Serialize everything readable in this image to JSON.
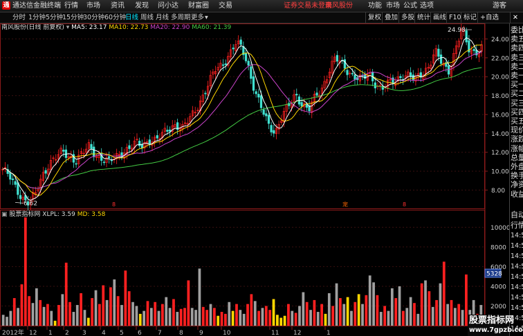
{
  "menubar": {
    "app_title": "通达信金融终端",
    "menus": [
      "行情",
      "市场",
      "资讯",
      "发现",
      "问小达",
      "财富圈",
      "交易"
    ],
    "notice": "证券交易未登录",
    "stock_name": "南风股份",
    "right_menus": [
      "功能",
      "市场",
      "公式",
      "选项"
    ],
    "user": "游客"
  },
  "toolbar": {
    "periods": [
      "分时",
      "1分钟",
      "5分钟",
      "15分钟",
      "30分钟",
      "60分钟",
      "日线",
      "周线",
      "月线",
      "多周期",
      "更多"
    ],
    "active_period": "日线",
    "right_buttons": [
      "复权",
      "叠加",
      "多股",
      "统计",
      "画线",
      "F10",
      "标记",
      "+自选"
    ]
  },
  "main_legend": {
    "title": "南风股份(日线 前复权)",
    "ma5": "MA5: 23.17",
    "ma10": "MA10: 22.73",
    "ma20": "MA20: 22.90",
    "ma60": "MA60: 21.39"
  },
  "volume_legend": {
    "title": "股票指标网",
    "xlpl": "XLPL: 3.59",
    "md": "MD: 3.58"
  },
  "annotations": {
    "high_label": "24.98",
    "low_label": "6.62",
    "markers": [
      "8",
      "宠",
      "8"
    ]
  },
  "price_axis": [
    "24.00",
    "22.00",
    "20.00",
    "18.00",
    "16.00",
    "14.00",
    "12.00",
    "10.00",
    "8.00"
  ],
  "volume_axis": [
    "10000",
    "8000",
    "6000",
    "4000",
    "2000"
  ],
  "volume_current": "5328",
  "date_axis": [
    "2012年",
    "12",
    "1",
    "2",
    "3",
    "4",
    "5",
    "6",
    "7",
    "8",
    "9",
    "10",
    "11",
    "12",
    "1"
  ],
  "side_panel": {
    "top": [
      "委比",
      "卖五",
      "卖四",
      "卖三",
      "卖二",
      "卖一",
      "买一",
      "买二",
      "买三",
      "买四",
      "买五",
      "现价",
      "涨跌",
      "涨幅",
      "总量",
      "外盘",
      "换手",
      "净资",
      "收益"
    ],
    "bottom": [
      "自动",
      "行情",
      "14:50",
      "14:50",
      "14:50",
      "14:50",
      "14:50",
      "14:50",
      "14:50",
      "14:50",
      "14:50",
      "14:50"
    ]
  },
  "watermark": {
    "line1": "股票指标网",
    "line2": "www.7gpzb.com"
  },
  "colors": {
    "up": "#ff2020",
    "down": "#a0a0a0",
    "ma5": "#ffffff",
    "ma10": "#ffd700",
    "ma20": "#cc44cc",
    "ma60": "#44cc44",
    "active": "#00e5ff"
  },
  "chart_data": {
    "type": "bar",
    "title": "南风股份(日线 前复权)",
    "price_range": [
      6.62,
      24.98
    ],
    "ylim_price": [
      6.5,
      25.2
    ],
    "ylim_volume": [
      0,
      11500
    ],
    "price_path": [
      10.2,
      9.4,
      8.2,
      7.2,
      6.62,
      7.6,
      9.6,
      10.9,
      11.4,
      12.0,
      11.6,
      11.2,
      11.8,
      12.6,
      11.8,
      11.3,
      10.9,
      11.5,
      12.1,
      12.4,
      12.9,
      12.7,
      13.4,
      13.2,
      13.8,
      14.6,
      15.0,
      14.4,
      15.4,
      16.6,
      17.8,
      19.2,
      20.8,
      21.4,
      22.2,
      23.4,
      23.1,
      21.0,
      18.2,
      16.4,
      14.9,
      14.2,
      15.8,
      16.8,
      18.2,
      17.2,
      16.4,
      17.8,
      18.8,
      20.6,
      21.9,
      21.3,
      20.6,
      20.0,
      19.6,
      20.3,
      19.4,
      18.7,
      19.2,
      19.6,
      20.2,
      20.1,
      19.6,
      20.4,
      21.1,
      22.6,
      21.4,
      20.6,
      22.8,
      24.98,
      22.9,
      22.6,
      23.2
    ],
    "volume_bars": [
      {
        "v": 1100,
        "c": "down"
      },
      {
        "v": 900,
        "c": "down"
      },
      {
        "v": 1500,
        "c": "down"
      },
      {
        "v": 2800,
        "c": "up"
      },
      {
        "v": 1800,
        "c": "down"
      },
      {
        "v": 4200,
        "c": "up"
      },
      {
        "v": 11000,
        "c": "up"
      },
      {
        "v": 3000,
        "c": "up"
      },
      {
        "v": 2300,
        "c": "down"
      },
      {
        "v": 3800,
        "c": "down"
      },
      {
        "v": 2600,
        "c": "up"
      },
      {
        "v": 1900,
        "c": "down"
      },
      {
        "v": 2200,
        "c": "up"
      },
      {
        "v": 1500,
        "c": "down"
      },
      {
        "v": 500,
        "c": "yellow"
      },
      {
        "v": 2100,
        "c": "up"
      },
      {
        "v": 3200,
        "c": "down"
      },
      {
        "v": 6400,
        "c": "up"
      },
      {
        "v": 2400,
        "c": "up"
      },
      {
        "v": 1400,
        "c": "down"
      },
      {
        "v": 2100,
        "c": "down"
      },
      {
        "v": 3300,
        "c": "up"
      },
      {
        "v": 1600,
        "c": "down"
      },
      {
        "v": 800,
        "c": "yellow"
      },
      {
        "v": 2800,
        "c": "up"
      },
      {
        "v": 3600,
        "c": "down"
      },
      {
        "v": 2200,
        "c": "up"
      },
      {
        "v": 4100,
        "c": "up"
      },
      {
        "v": 2600,
        "c": "down"
      },
      {
        "v": 3900,
        "c": "up"
      },
      {
        "v": 4700,
        "c": "down"
      },
      {
        "v": 3000,
        "c": "up"
      },
      {
        "v": 2100,
        "c": "down"
      },
      {
        "v": 5600,
        "c": "up"
      },
      {
        "v": 3500,
        "c": "up"
      },
      {
        "v": 2400,
        "c": "down"
      },
      {
        "v": 2000,
        "c": "down"
      },
      {
        "v": 1200,
        "c": "yellow"
      },
      {
        "v": 1500,
        "c": "down"
      },
      {
        "v": 2500,
        "c": "up"
      },
      {
        "v": 1800,
        "c": "down"
      },
      {
        "v": 2400,
        "c": "up"
      },
      {
        "v": 1500,
        "c": "down"
      },
      {
        "v": 2200,
        "c": "up"
      },
      {
        "v": 2900,
        "c": "down"
      },
      {
        "v": 1800,
        "c": "down"
      },
      {
        "v": 2700,
        "c": "up"
      },
      {
        "v": 1400,
        "c": "down"
      },
      {
        "v": 1700,
        "c": "up"
      },
      {
        "v": 1800,
        "c": "up"
      },
      {
        "v": 4600,
        "c": "up"
      },
      {
        "v": 1800,
        "c": "down"
      },
      {
        "v": 1600,
        "c": "down"
      },
      {
        "v": 5800,
        "c": "down"
      },
      {
        "v": 1900,
        "c": "up"
      },
      {
        "v": 1600,
        "c": "up"
      },
      {
        "v": 2200,
        "c": "down"
      },
      {
        "v": 1800,
        "c": "up"
      },
      {
        "v": 1000,
        "c": "yellow"
      },
      {
        "v": 1400,
        "c": "up"
      },
      {
        "v": 1200,
        "c": "up"
      },
      {
        "v": 2400,
        "c": "down"
      },
      {
        "v": 1500,
        "c": "yellow"
      },
      {
        "v": 2200,
        "c": "up"
      },
      {
        "v": 1600,
        "c": "down"
      },
      {
        "v": 1200,
        "c": "down"
      },
      {
        "v": 2200,
        "c": "up"
      },
      {
        "v": 3200,
        "c": "up"
      },
      {
        "v": 2500,
        "c": "down"
      },
      {
        "v": 1500,
        "c": "up"
      },
      {
        "v": 1800,
        "c": "down"
      },
      {
        "v": 2000,
        "c": "up"
      },
      {
        "v": 1600,
        "c": "up"
      },
      {
        "v": 2700,
        "c": "yellow"
      },
      {
        "v": 1100,
        "c": "yellow"
      },
      {
        "v": 800,
        "c": "yellow"
      },
      {
        "v": 1000,
        "c": "yellow"
      },
      {
        "v": 2200,
        "c": "up"
      },
      {
        "v": 1500,
        "c": "down"
      },
      {
        "v": 1300,
        "c": "up"
      },
      {
        "v": 2000,
        "c": "down"
      },
      {
        "v": 3400,
        "c": "down"
      },
      {
        "v": 2400,
        "c": "up"
      },
      {
        "v": 1600,
        "c": "down"
      },
      {
        "v": 2600,
        "c": "up"
      },
      {
        "v": 1400,
        "c": "down"
      },
      {
        "v": 2200,
        "c": "up"
      },
      {
        "v": 1200,
        "c": "yellow"
      },
      {
        "v": 3300,
        "c": "down"
      },
      {
        "v": 2000,
        "c": "up"
      },
      {
        "v": 4300,
        "c": "down"
      },
      {
        "v": 2800,
        "c": "up"
      },
      {
        "v": 2200,
        "c": "down"
      },
      {
        "v": 2900,
        "c": "yellow"
      },
      {
        "v": 1500,
        "c": "down"
      },
      {
        "v": 2400,
        "c": "up"
      },
      {
        "v": 3200,
        "c": "yellow"
      },
      {
        "v": 2200,
        "c": "down"
      },
      {
        "v": 3100,
        "c": "up"
      },
      {
        "v": 5100,
        "c": "down"
      },
      {
        "v": 4400,
        "c": "down"
      },
      {
        "v": 3100,
        "c": "up"
      },
      {
        "v": 1400,
        "c": "down"
      },
      {
        "v": 2000,
        "c": "up"
      },
      {
        "v": 1500,
        "c": "down"
      },
      {
        "v": 3800,
        "c": "down"
      },
      {
        "v": 2800,
        "c": "up"
      },
      {
        "v": 4000,
        "c": "down"
      },
      {
        "v": 1500,
        "c": "up"
      },
      {
        "v": 1800,
        "c": "down"
      },
      {
        "v": 2900,
        "c": "down"
      },
      {
        "v": 2300,
        "c": "up"
      },
      {
        "v": 1200,
        "c": "down"
      },
      {
        "v": 4300,
        "c": "up"
      },
      {
        "v": 4600,
        "c": "down"
      },
      {
        "v": 3500,
        "c": "up"
      },
      {
        "v": 1900,
        "c": "down"
      },
      {
        "v": 2600,
        "c": "up"
      },
      {
        "v": 4300,
        "c": "down"
      },
      {
        "v": 6500,
        "c": "up"
      },
      {
        "v": 2200,
        "c": "down"
      },
      {
        "v": 2600,
        "c": "up"
      },
      {
        "v": 1800,
        "c": "down"
      },
      {
        "v": 2200,
        "c": "up"
      },
      {
        "v": 1600,
        "c": "down"
      },
      {
        "v": 5200,
        "c": "up"
      },
      {
        "v": 1600,
        "c": "down"
      },
      {
        "v": 2600,
        "c": "down"
      },
      {
        "v": 1200,
        "c": "up"
      },
      {
        "v": 2100,
        "c": "down"
      }
    ]
  }
}
